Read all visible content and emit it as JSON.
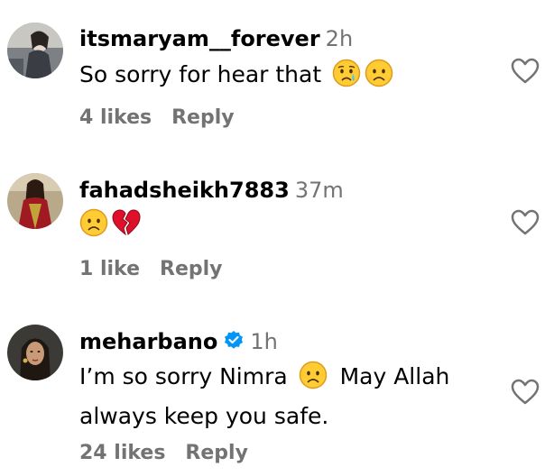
{
  "comments": [
    {
      "username": "itsmaryam__forever",
      "time": "2h",
      "text": "So sorry for hear that",
      "emojis": [
        "crying-face-emoji",
        "sad-face-emoji"
      ],
      "likes": "4 likes",
      "reply": "Reply",
      "verified": false
    },
    {
      "username": "fahadsheikh7883",
      "time": "37m",
      "text": "",
      "emojis": [
        "sad-face-emoji",
        "broken-heart-emoji"
      ],
      "likes": "1 like",
      "reply": "Reply",
      "verified": false
    },
    {
      "username": "meharbano",
      "time": "1h",
      "text_part1": "I’m so sorry Nimra",
      "text_part2": "May Allah",
      "text_line2": "always keep you safe.",
      "emojis": [
        "sad-face-emoji"
      ],
      "likes": "24 likes",
      "reply": "Reply",
      "verified": true
    }
  ],
  "colors": {
    "text": "#000000",
    "muted": "#737373",
    "verified": "#0095f6",
    "emoji_yellow": "#ffcc33",
    "emoji_outline": "#e09a1c",
    "tear": "#4fc3f7",
    "broken_heart": "#e0102a"
  }
}
